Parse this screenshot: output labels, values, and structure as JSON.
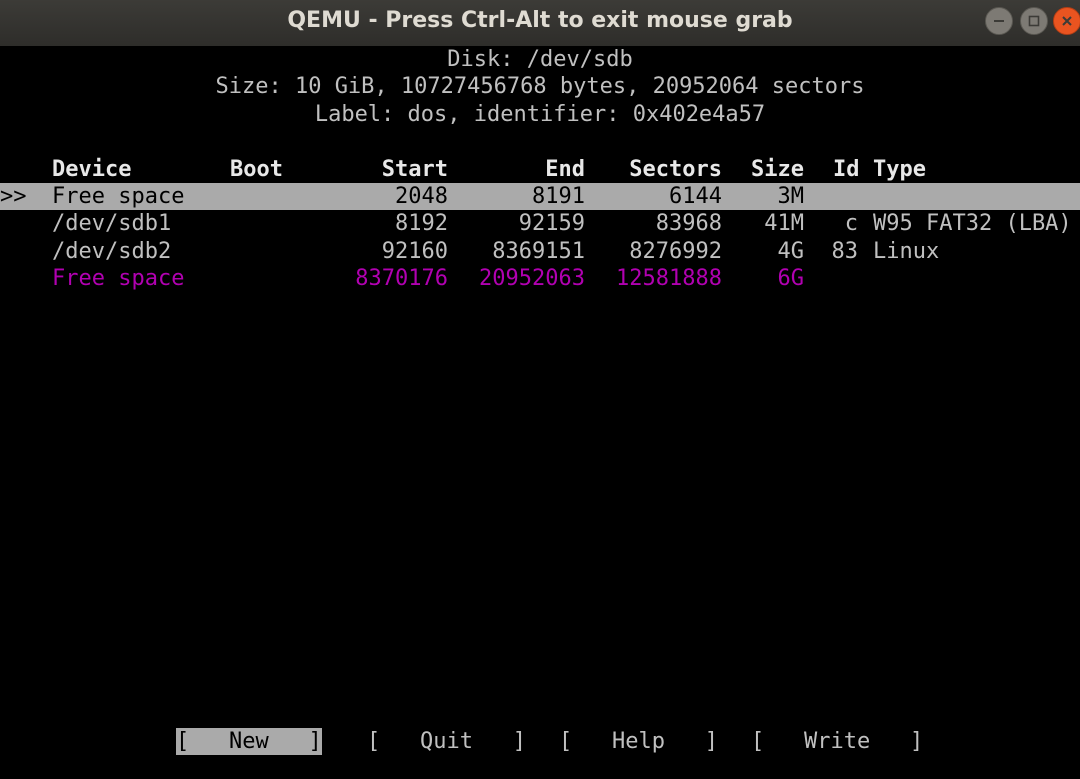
{
  "window": {
    "title": "QEMU - Press Ctrl-Alt to exit mouse grab"
  },
  "header": {
    "disk": "Disk: /dev/sdb",
    "size": "Size: 10 GiB, 10727456768 bytes, 20952064 sectors",
    "label": "Label: dos, identifier: 0x402e4a57"
  },
  "table": {
    "columns": {
      "device": "Device",
      "boot": "Boot",
      "start": "Start",
      "end": "End",
      "sectors": "Sectors",
      "size": "Size",
      "id": "Id",
      "type": "Type"
    },
    "rows": [
      {
        "cursor": ">>",
        "device": "Free space",
        "boot": "",
        "start": "2048",
        "end": "8191",
        "sectors": "6144",
        "size": "3M",
        "id": "",
        "type": ""
      },
      {
        "cursor": "",
        "device": "/dev/sdb1",
        "boot": "",
        "start": "8192",
        "end": "92159",
        "sectors": "83968",
        "size": "41M",
        "id": "c",
        "type": "W95 FAT32 (LBA)"
      },
      {
        "cursor": "",
        "device": "/dev/sdb2",
        "boot": "",
        "start": "92160",
        "end": "8369151",
        "sectors": "8276992",
        "size": "4G",
        "id": "83",
        "type": "Linux"
      },
      {
        "cursor": "",
        "device": "Free space",
        "boot": "",
        "start": "8370176",
        "end": "20952063",
        "sectors": "12581888",
        "size": "6G",
        "id": "",
        "type": ""
      }
    ]
  },
  "menu": {
    "new": "[   New   ]",
    "quit": "[   Quit   ]",
    "help": "[   Help   ]",
    "write": "[   Write   ]"
  },
  "colors": {
    "selected_bg": "#aaaaaa",
    "free_space": "#b100b1",
    "terminal_bg": "#000000",
    "terminal_fg": "#c0c0c0",
    "close_button": "#e95420"
  }
}
